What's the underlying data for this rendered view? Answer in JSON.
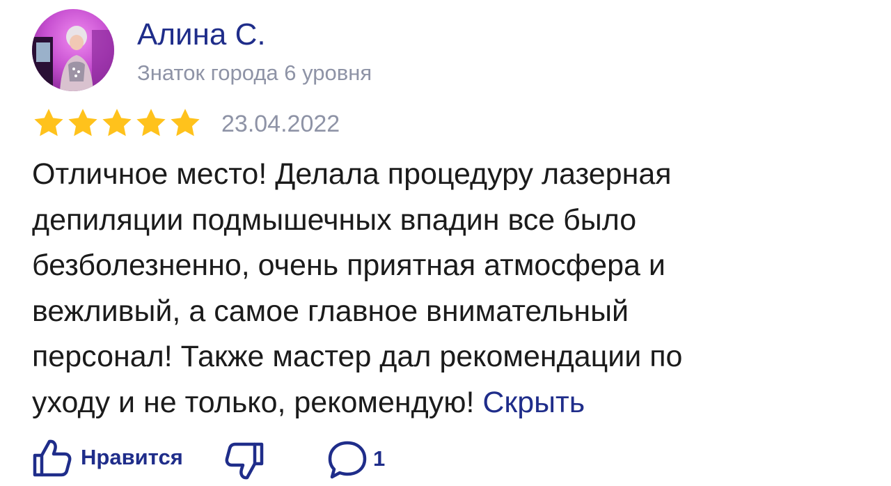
{
  "author": {
    "name": "Алина С.",
    "level": "Знаток города 6 уровня"
  },
  "rating": {
    "value": 5,
    "max": 5,
    "date": "23.04.2022"
  },
  "review": {
    "lines": [
      "Отличное место! Делала процедуру лазерная",
      "депиляции подмышечных впадин все было",
      "безболезненно, очень приятная атмосфера и",
      "вежливый, а самое главное внимательный",
      "персонал! Также мастер дал рекомендации по",
      "уходу и не только, рекомендую! "
    ],
    "collapse_label": "Скрыть"
  },
  "actions": {
    "like_label": "Нравится",
    "comment_count": "1"
  },
  "icons": {
    "avatar": "user-photo-icon",
    "star": "star-icon",
    "like": "thumbs-up-icon",
    "dislike": "thumbs-down-icon",
    "comment": "comment-bubble-icon"
  },
  "colors": {
    "accent": "#1f2d8a",
    "star": "#ffc21c",
    "muted": "#8e93a6",
    "text": "#1b1b1b"
  }
}
